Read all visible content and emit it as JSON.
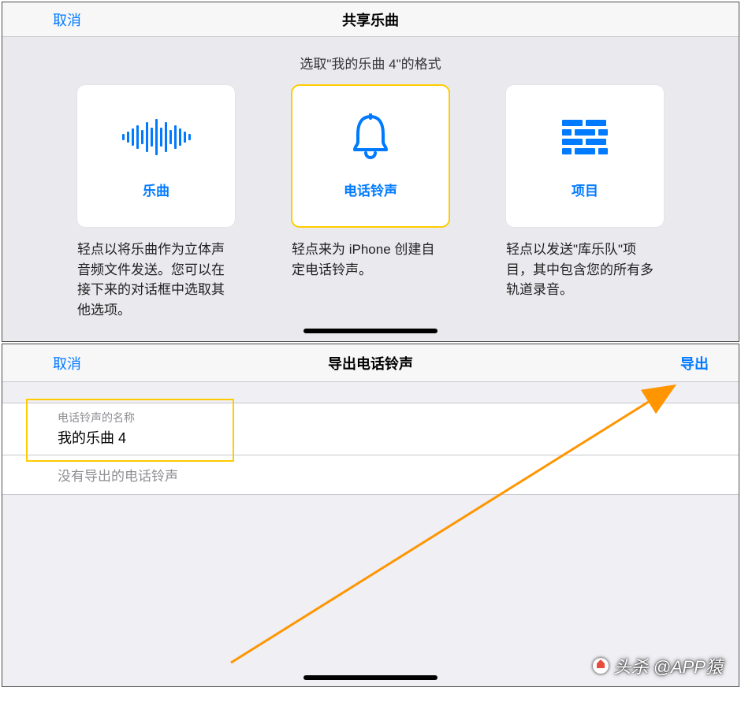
{
  "panel1": {
    "cancel": "取消",
    "title": "共享乐曲",
    "subtitle": "选取\"我的乐曲 4\"的格式",
    "cards": {
      "song": {
        "label": "乐曲",
        "desc": "轻点以将乐曲作为立体声音频文件发送。您可以在接下来的对话框中选取其他选项。"
      },
      "ringtone": {
        "label": "电话铃声",
        "desc": "轻点来为 iPhone 创建自定电话铃声。"
      },
      "project": {
        "label": "项目",
        "desc": "轻点以发送\"库乐队\"项目，其中包含您的所有多轨道录音。"
      }
    }
  },
  "panel2": {
    "cancel": "取消",
    "title": "导出电话铃声",
    "export": "导出",
    "name_caption": "电话铃声的名称",
    "name_value": "我的乐曲 4",
    "empty": "没有导出的电话铃声"
  },
  "credit": "头杀 @APP猿"
}
